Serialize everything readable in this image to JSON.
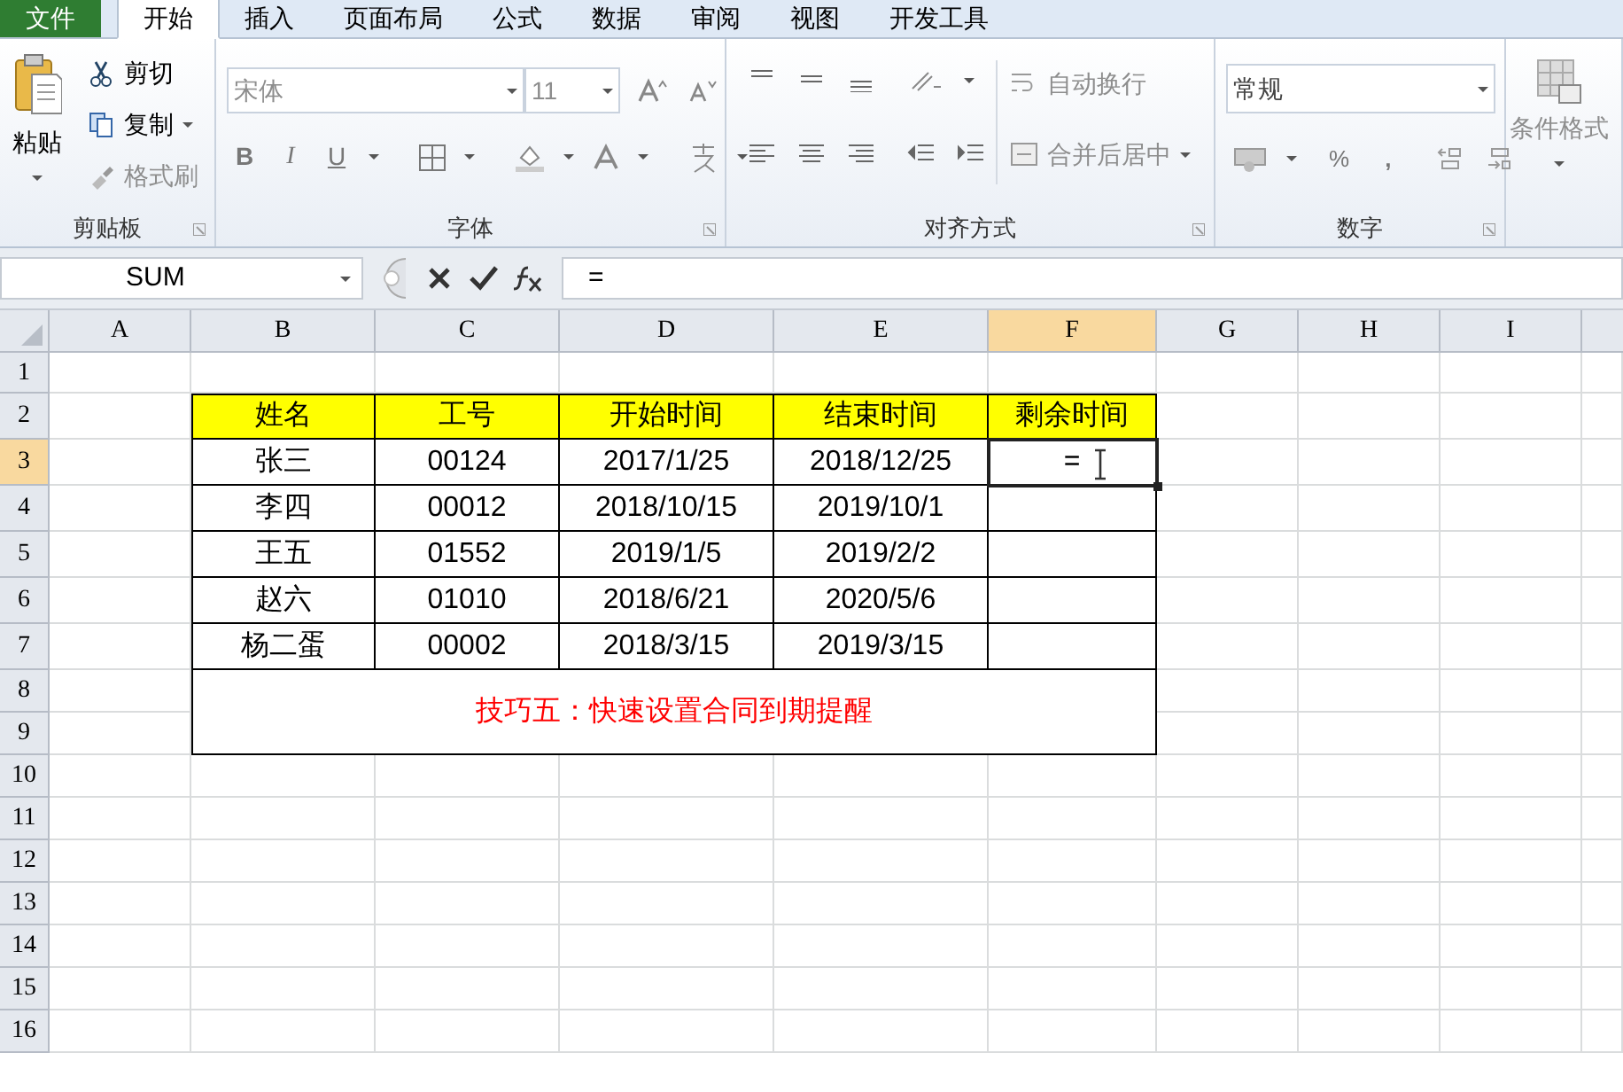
{
  "tabs": [
    {
      "label": "文件",
      "kind": "file",
      "selected": false
    },
    {
      "label": "开始",
      "kind": "tab",
      "selected": true
    },
    {
      "label": "插入",
      "kind": "tab",
      "selected": false
    },
    {
      "label": "页面布局",
      "kind": "tab",
      "selected": false
    },
    {
      "label": "公式",
      "kind": "tab",
      "selected": false
    },
    {
      "label": "数据",
      "kind": "tab",
      "selected": false
    },
    {
      "label": "审阅",
      "kind": "tab",
      "selected": false
    },
    {
      "label": "视图",
      "kind": "tab",
      "selected": false
    },
    {
      "label": "开发工具",
      "kind": "tab",
      "selected": false
    }
  ],
  "ribbon": {
    "clipboard": {
      "label": "剪贴板",
      "paste": "粘贴",
      "cut": {
        "label": "剪切",
        "disabled": false
      },
      "copy": {
        "label": "复制",
        "disabled": false
      },
      "format_painter": {
        "label": "格式刷",
        "disabled": true
      }
    },
    "font": {
      "label": "字体",
      "font_name": "宋体",
      "font_size": "11",
      "bold": "B",
      "italic": "I",
      "underline": "U"
    },
    "alignment": {
      "label": "对齐方式",
      "wrap_text": {
        "label": "自动换行",
        "disabled": true
      },
      "merge_center": {
        "label": "合并后居中",
        "disabled": true
      }
    },
    "number": {
      "label": "数字",
      "format": "常规",
      "percent": "%",
      "comma": ","
    },
    "styles": {
      "conditional_formatting": {
        "label": "条件格式",
        "disabled": true
      }
    }
  },
  "formula_bar": {
    "name_box": "SUM",
    "formula": "="
  },
  "sheet": {
    "columns": [
      {
        "label": "A",
        "selected": false
      },
      {
        "label": "B",
        "selected": false
      },
      {
        "label": "C",
        "selected": false
      },
      {
        "label": "D",
        "selected": false
      },
      {
        "label": "E",
        "selected": false
      },
      {
        "label": "F",
        "selected": true
      },
      {
        "label": "G",
        "selected": false
      },
      {
        "label": "H",
        "selected": false
      },
      {
        "label": "I",
        "selected": false
      }
    ],
    "rows": [
      {
        "label": "1",
        "selected": false
      },
      {
        "label": "2",
        "selected": false
      },
      {
        "label": "3",
        "selected": true
      },
      {
        "label": "4",
        "selected": false
      },
      {
        "label": "5",
        "selected": false
      },
      {
        "label": "6",
        "selected": false
      },
      {
        "label": "7",
        "selected": false
      },
      {
        "label": "8",
        "selected": false
      },
      {
        "label": "9",
        "selected": false
      },
      {
        "label": "10",
        "selected": false
      },
      {
        "label": "11",
        "selected": false
      },
      {
        "label": "12",
        "selected": false
      },
      {
        "label": "13",
        "selected": false
      },
      {
        "label": "14",
        "selected": false
      },
      {
        "label": "15",
        "selected": false
      },
      {
        "label": "16",
        "selected": false
      }
    ],
    "table": {
      "header": [
        "姓名",
        "工号",
        "开始时间",
        "结束时间",
        "剩余时间"
      ],
      "rows": [
        [
          "张三",
          "00124",
          "2017/1/25",
          "2018/12/25",
          "="
        ],
        [
          "李四",
          "00012",
          "2018/10/15",
          "2019/10/1"
        ],
        [
          "王五",
          "01552",
          "2019/1/5",
          "2019/2/2"
        ],
        [
          "赵六",
          "01010",
          "2018/6/21",
          "2020/5/6"
        ],
        [
          "杨二蛋",
          "00002",
          "2018/3/15",
          "2019/3/15"
        ]
      ],
      "note": "技巧五：快速设置合同到期提醒"
    }
  }
}
